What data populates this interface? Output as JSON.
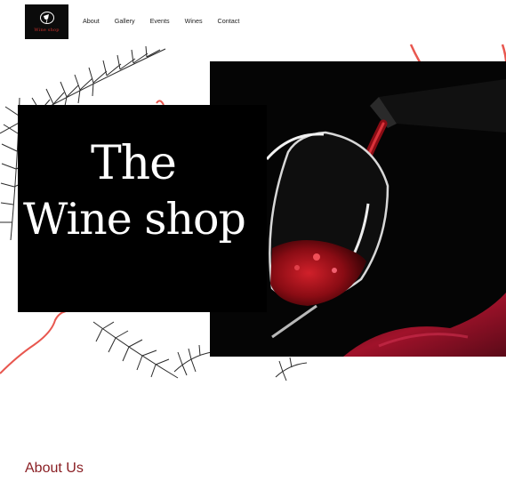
{
  "brand": {
    "logo_text": "Wine shop",
    "logo_icon": "wine-glass-logo-icon"
  },
  "nav": {
    "items": [
      {
        "label": "About"
      },
      {
        "label": "Gallery"
      },
      {
        "label": "Events"
      },
      {
        "label": "Wines"
      },
      {
        "label": "Contact"
      }
    ]
  },
  "hero": {
    "title_line_1": "The",
    "title_line_2": "Wine shop",
    "image": "red-wine-pouring-into-glass",
    "decorations": [
      "pine-branch-icon",
      "red-line-doodle"
    ]
  },
  "about": {
    "heading": "About Us"
  },
  "colors": {
    "accent_red": "#e8574f",
    "heading_red": "#8a1f24",
    "dark": "#000000",
    "background": "#ffffff"
  }
}
